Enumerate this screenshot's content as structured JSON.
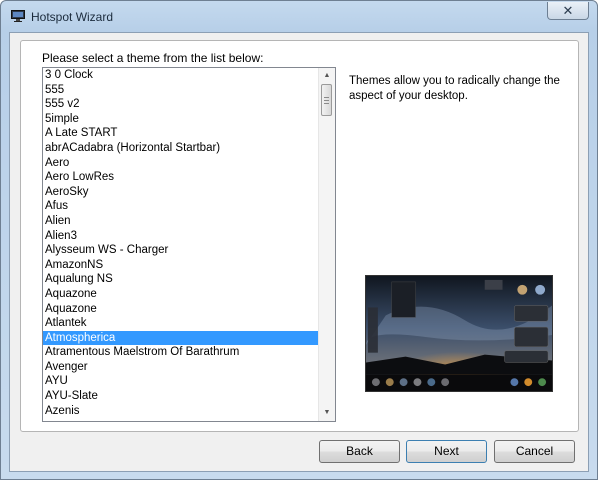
{
  "window": {
    "title": "Hotspot Wizard",
    "icon": "monitor-app-icon",
    "close_glyph": "✕"
  },
  "prompt": "Please select a theme from the list below:",
  "themes": [
    "3 0 Clock",
    "555",
    "555 v2",
    "5imple",
    "A Late START",
    "abrACadabra (Horizontal Startbar)",
    "Aero",
    "Aero LowRes",
    "AeroSky",
    "Afus",
    "Alien",
    "Alien3",
    "Alysseum WS - Charger",
    "AmazonNS",
    "Aqualung NS",
    "Aquazone",
    "Aquazone",
    "Atlantek",
    "Atmospherica",
    "Atramentous Maelstrom Of Barathrum",
    "Avenger",
    "AYU",
    "AYU-Slate",
    "Azenis"
  ],
  "selected_theme": "Atmospherica",
  "description": "Themes allow you to radically change the aspect of your desktop.",
  "buttons": {
    "back": "Back",
    "next": "Next",
    "cancel": "Cancel"
  },
  "colors": {
    "selection": "#3399ff",
    "title_bar": "#c4d9ee"
  }
}
